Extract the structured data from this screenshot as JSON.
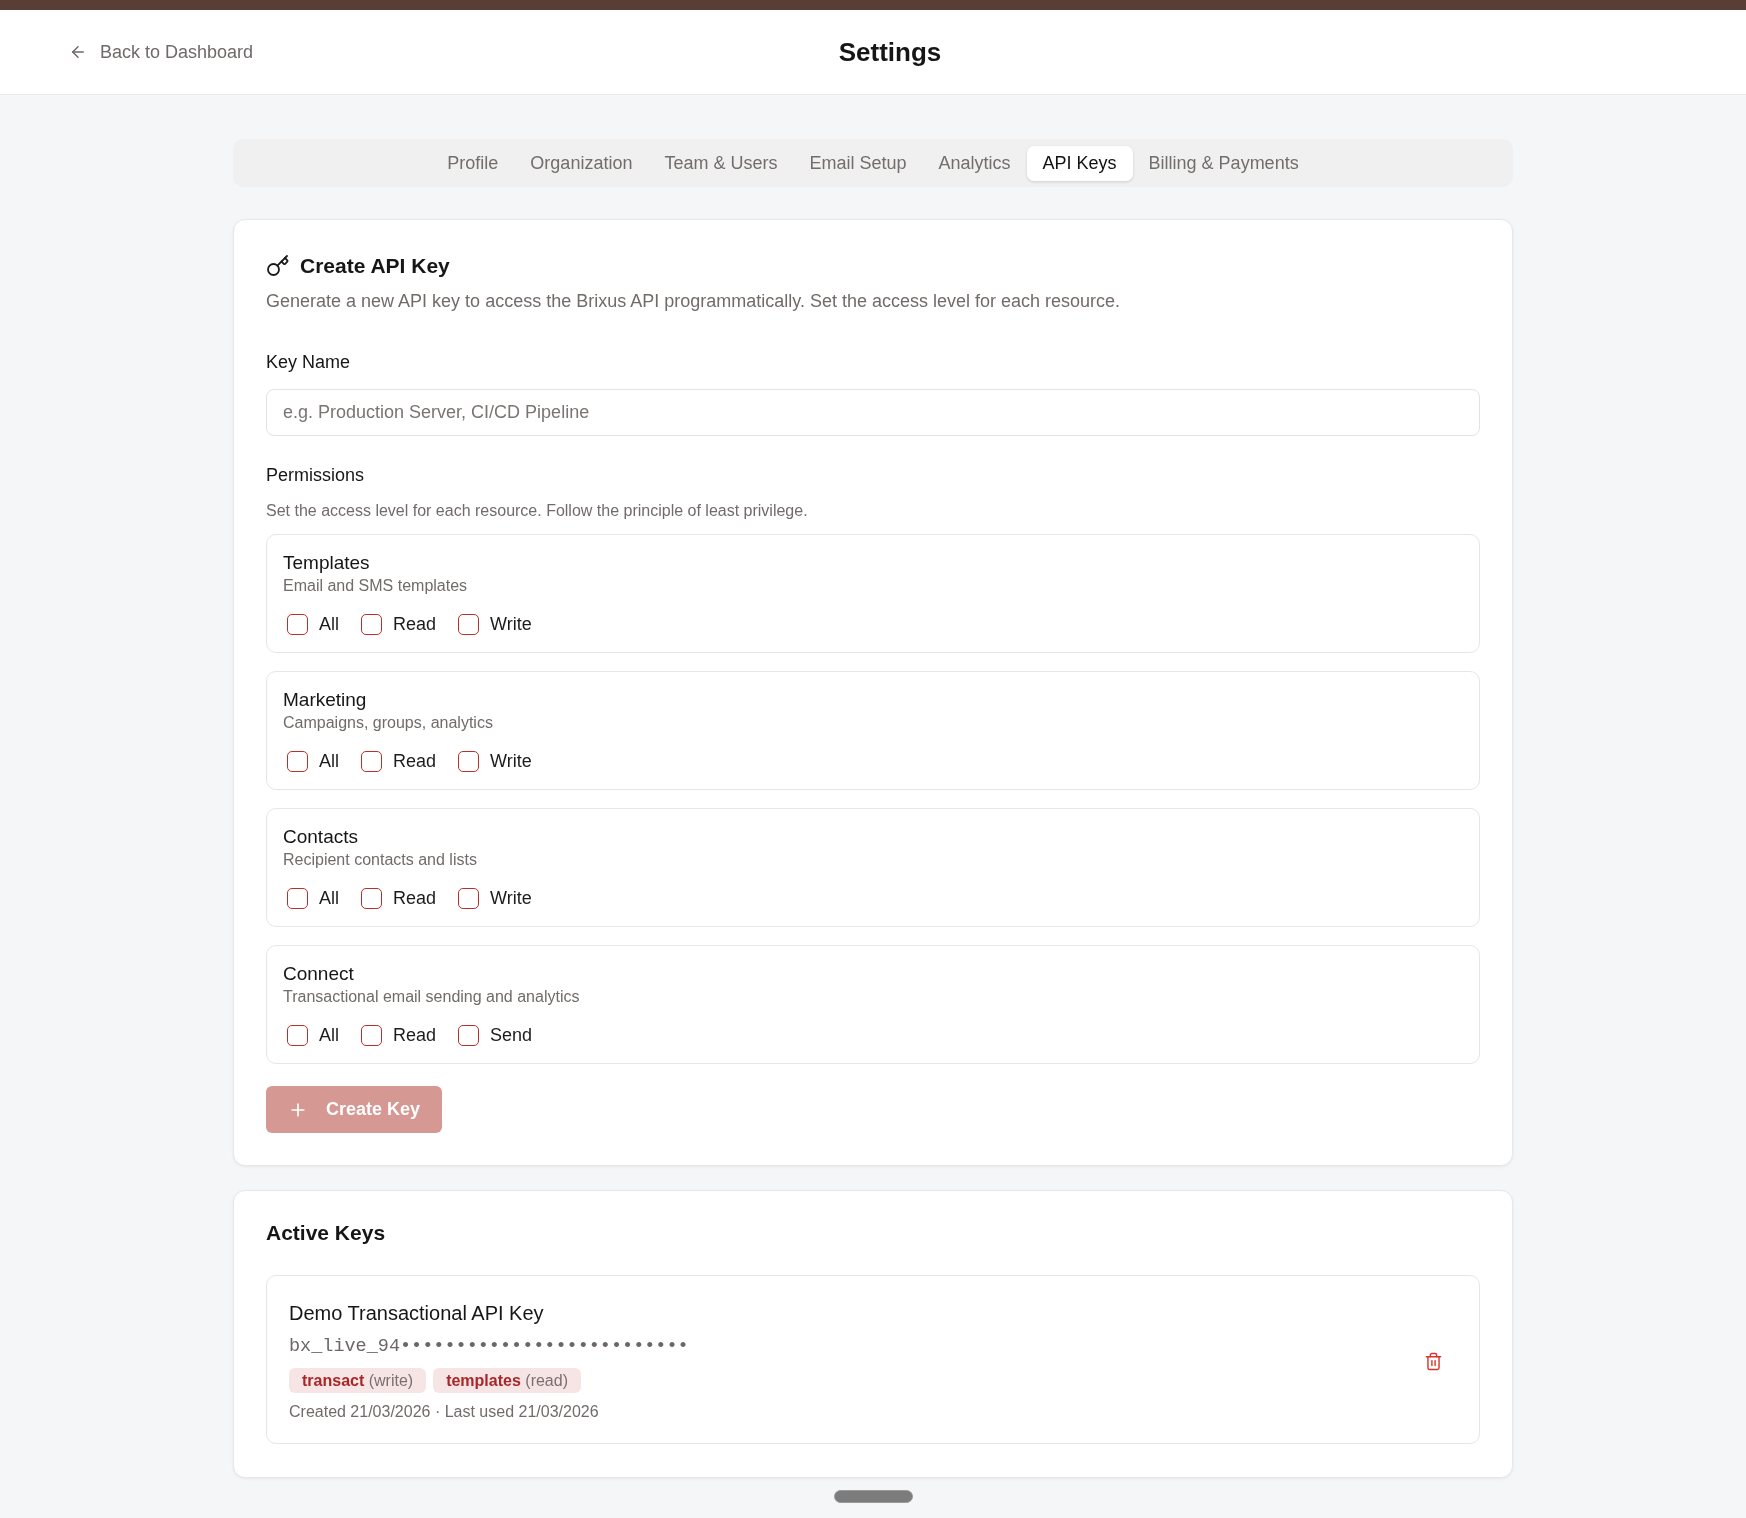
{
  "header": {
    "back_link": "Back to Dashboard",
    "title": "Settings"
  },
  "tabs": [
    {
      "label": "Profile",
      "selected": false
    },
    {
      "label": "Organization",
      "selected": false
    },
    {
      "label": "Team & Users",
      "selected": false
    },
    {
      "label": "Email Setup",
      "selected": false
    },
    {
      "label": "Analytics",
      "selected": false
    },
    {
      "label": "API Keys",
      "selected": true
    },
    {
      "label": "Billing & Payments",
      "selected": false
    }
  ],
  "create_key": {
    "title": "Create API Key",
    "description": "Generate a new API key to access the Brixus API programmatically. Set the access level for each resource.",
    "key_name": {
      "label": "Key Name",
      "placeholder": "e.g. Production Server, CI/CD Pipeline"
    },
    "permissions": {
      "label": "Permissions",
      "hint": "Set the access level for each resource. Follow the principle of least privilege.",
      "resources": [
        {
          "name": "Templates",
          "description": "Email and SMS templates",
          "options": [
            {
              "label": "All",
              "checked": false
            },
            {
              "label": "Read",
              "checked": false
            },
            {
              "label": "Write",
              "checked": false
            }
          ]
        },
        {
          "name": "Marketing",
          "description": "Campaigns, groups, analytics",
          "options": [
            {
              "label": "All",
              "checked": false
            },
            {
              "label": "Read",
              "checked": false
            },
            {
              "label": "Write",
              "checked": false
            }
          ]
        },
        {
          "name": "Contacts",
          "description": "Recipient contacts and lists",
          "options": [
            {
              "label": "All",
              "checked": false
            },
            {
              "label": "Read",
              "checked": false
            },
            {
              "label": "Write",
              "checked": false
            }
          ]
        },
        {
          "name": "Connect",
          "description": "Transactional email sending and analytics",
          "options": [
            {
              "label": "All",
              "checked": false
            },
            {
              "label": "Read",
              "checked": false
            },
            {
              "label": "Send",
              "checked": false
            }
          ]
        }
      ]
    },
    "button": {
      "label": "Create Key",
      "disabled": true
    }
  },
  "active_keys": {
    "title": "Active Keys",
    "keys": [
      {
        "name": "Demo Transactional API Key",
        "masked_key": "bx_live_94••••••••••••••••••••••••••",
        "tags": [
          {
            "resource": "transact",
            "access": "(write)"
          },
          {
            "resource": "templates",
            "access": "(read)"
          }
        ],
        "dates": "Created 21/03/2026 · Last used 21/03/2026"
      }
    ]
  }
}
